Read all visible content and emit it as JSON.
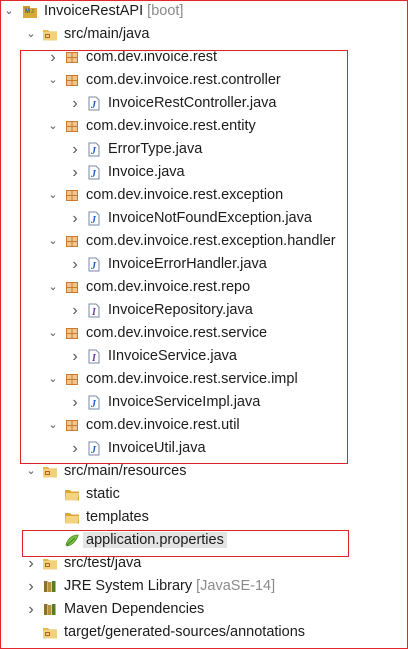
{
  "project": {
    "name": "InvoiceRestAPI",
    "tag": "[boot]"
  },
  "nodes": [
    {
      "name": "project-root",
      "label": "InvoiceRestAPI",
      "icon": "project-icon",
      "indent": 0,
      "twisty": "open"
    },
    {
      "name": "source-folder-main-java",
      "label": "src/main/java",
      "icon": "source-folder-icon",
      "indent": 1,
      "twisty": "open"
    },
    {
      "name": "package-rest",
      "label": "com.dev.invoice.rest",
      "icon": "package-icon",
      "indent": 2,
      "twisty": "closed"
    },
    {
      "name": "package-controller",
      "label": "com.dev.invoice.rest.controller",
      "icon": "package-icon",
      "indent": 2,
      "twisty": "open"
    },
    {
      "name": "file-invoice-rest-controller",
      "label": "InvoiceRestController.java",
      "icon": "java-file-icon",
      "indent": 3,
      "twisty": "closed"
    },
    {
      "name": "package-entity",
      "label": "com.dev.invoice.rest.entity",
      "icon": "package-icon",
      "indent": 2,
      "twisty": "open"
    },
    {
      "name": "file-error-type",
      "label": "ErrorType.java",
      "icon": "java-file-icon",
      "indent": 3,
      "twisty": "closed"
    },
    {
      "name": "file-invoice",
      "label": "Invoice.java",
      "icon": "java-file-icon",
      "indent": 3,
      "twisty": "closed"
    },
    {
      "name": "package-exception",
      "label": "com.dev.invoice.rest.exception",
      "icon": "package-icon",
      "indent": 2,
      "twisty": "open"
    },
    {
      "name": "file-invoice-not-found-exception",
      "label": "InvoiceNotFoundException.java",
      "icon": "java-file-icon",
      "indent": 3,
      "twisty": "closed"
    },
    {
      "name": "package-exception-handler",
      "label": "com.dev.invoice.rest.exception.handler",
      "icon": "package-icon",
      "indent": 2,
      "twisty": "open"
    },
    {
      "name": "file-invoice-error-handler",
      "label": "InvoiceErrorHandler.java",
      "icon": "java-file-icon",
      "indent": 3,
      "twisty": "closed"
    },
    {
      "name": "package-repo",
      "label": "com.dev.invoice.rest.repo",
      "icon": "package-icon",
      "indent": 2,
      "twisty": "open"
    },
    {
      "name": "file-invoice-repository",
      "label": "InvoiceRepository.java",
      "icon": "java-interface-icon",
      "indent": 3,
      "twisty": "closed"
    },
    {
      "name": "package-service",
      "label": "com.dev.invoice.rest.service",
      "icon": "package-icon",
      "indent": 2,
      "twisty": "open"
    },
    {
      "name": "file-iinvoice-service",
      "label": "IInvoiceService.java",
      "icon": "java-interface-icon",
      "indent": 3,
      "twisty": "closed"
    },
    {
      "name": "package-service-impl",
      "label": "com.dev.invoice.rest.service.impl",
      "icon": "package-icon",
      "indent": 2,
      "twisty": "open"
    },
    {
      "name": "file-invoice-service-impl",
      "label": "InvoiceServiceImpl.java",
      "icon": "java-file-icon",
      "indent": 3,
      "twisty": "closed"
    },
    {
      "name": "package-util",
      "label": "com.dev.invoice.rest.util",
      "icon": "package-icon",
      "indent": 2,
      "twisty": "open"
    },
    {
      "name": "file-invoice-util",
      "label": "InvoiceUtil.java",
      "icon": "java-file-icon",
      "indent": 3,
      "twisty": "closed"
    },
    {
      "name": "source-folder-main-resources",
      "label": "src/main/resources",
      "icon": "source-folder-icon",
      "indent": 1,
      "twisty": "open"
    },
    {
      "name": "folder-static",
      "label": "static",
      "icon": "folder-icon",
      "indent": 2,
      "twisty": "none"
    },
    {
      "name": "folder-templates",
      "label": "templates",
      "icon": "folder-icon",
      "indent": 2,
      "twisty": "none"
    },
    {
      "name": "file-application-properties",
      "label": "application.properties",
      "icon": "properties-file-icon",
      "indent": 2,
      "twisty": "none",
      "selected": true
    },
    {
      "name": "source-folder-test-java",
      "label": "src/test/java",
      "icon": "source-folder-icon",
      "indent": 1,
      "twisty": "closed"
    },
    {
      "name": "library-jre",
      "label": "JRE System Library",
      "suffix": "[JavaSE-14]",
      "icon": "library-icon",
      "indent": 1,
      "twisty": "closed"
    },
    {
      "name": "library-maven",
      "label": "Maven Dependencies",
      "icon": "library-icon",
      "indent": 1,
      "twisty": "closed"
    },
    {
      "name": "folder-generated-sources",
      "label": "target/generated-sources/annotations",
      "icon": "source-folder-icon",
      "indent": 1,
      "twisty": "none"
    }
  ],
  "colors": {
    "highlight_border": "#d9262b",
    "outer_border": "#e3262b",
    "package_icon": "#b5651d",
    "java_icon": "#1f5fbf",
    "folder_icon": "#e6b94d",
    "properties_icon": "#6cb43f"
  }
}
